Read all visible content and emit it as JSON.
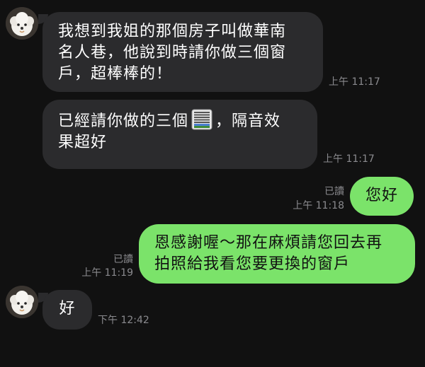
{
  "messages": [
    {
      "sender": "other",
      "lines": [
        "我想到我姐的那個房子叫做華南",
        "名人巷，他說到時請你做三個窗",
        "戶，超棒棒的！"
      ],
      "time": "上午 11:17"
    },
    {
      "sender": "other",
      "pre": "已經請你做的三個",
      "emoji": "window-blinds-icon",
      "post": "，隔音效",
      "line2": "果超好",
      "time": "上午 11:17"
    },
    {
      "sender": "me",
      "text": "您好",
      "read": "已讀",
      "time": "上午 11:18"
    },
    {
      "sender": "me",
      "lines": [
        "恩感謝喔～那在麻煩請您回去再",
        "拍照給我看您要更換的窗戶"
      ],
      "read": "已讀",
      "time": "上午 11:19"
    },
    {
      "sender": "other",
      "text": "好",
      "time": "下午 12:42"
    }
  ],
  "colors": {
    "background": "#111111",
    "incoming_bubble": "#2b2b2d",
    "outgoing_bubble": "#7be36a",
    "meta_text": "#8a8a8e"
  },
  "avatar": {
    "icon": "white-dog-avatar"
  }
}
